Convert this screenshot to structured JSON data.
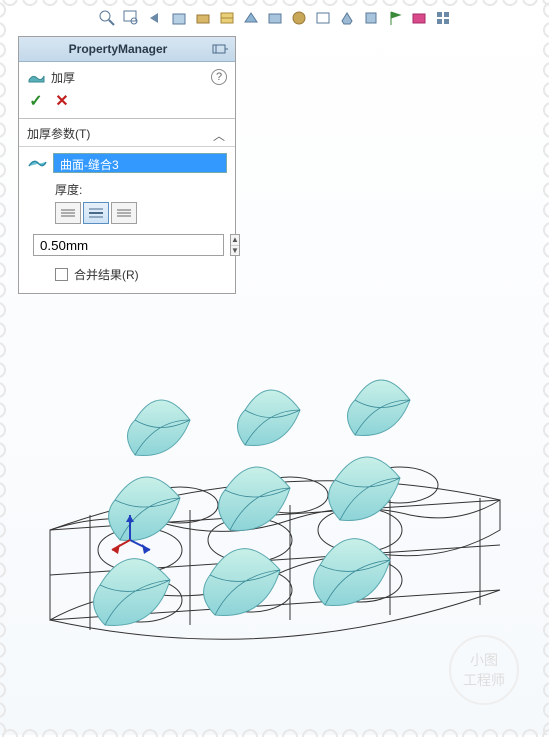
{
  "pm": {
    "header": "PropertyManager",
    "feature_title": "加厚",
    "help": "?",
    "ok": "✓",
    "cancel": "✕",
    "section_title": "加厚参数(T)",
    "collapse": "︿",
    "selection_value": "曲面-缝合3",
    "thickness_label": "厚度:",
    "dimension_value": "0.50mm",
    "merge_label": "合并结果(R)",
    "spin_up": "▲",
    "spin_down": "▼"
  },
  "watermark": {
    "line1": "小图",
    "line2": "工程师"
  }
}
